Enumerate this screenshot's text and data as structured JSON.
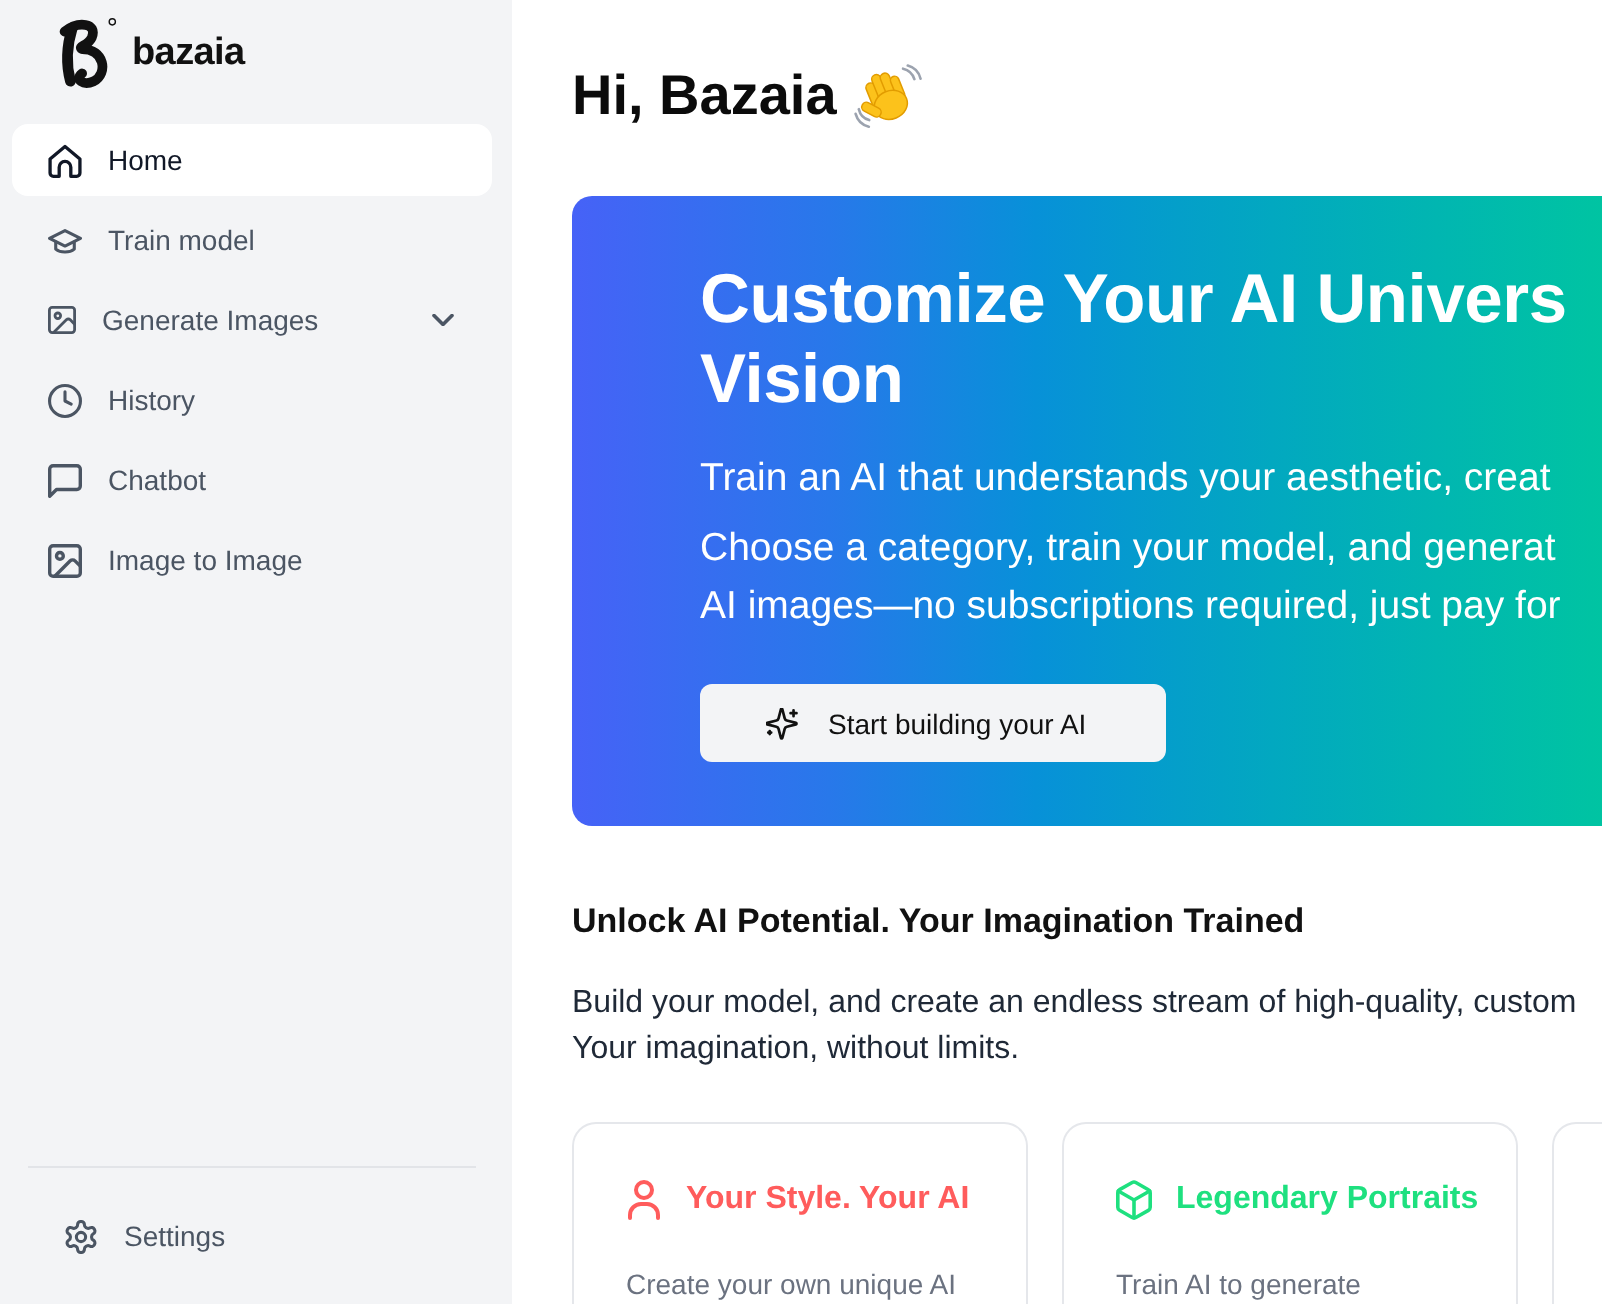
{
  "sidebar": {
    "brand": {
      "name": "bazaia"
    },
    "nav_items": [
      {
        "label": "Home",
        "selected": true,
        "kind": "link"
      },
      {
        "label": "Train model",
        "selected": false,
        "kind": "link"
      },
      {
        "label": "Generate Images",
        "selected": false,
        "kind": "group",
        "expanded": false
      },
      {
        "label": "History",
        "selected": false,
        "kind": "link"
      },
      {
        "label": "Chatbot",
        "selected": false,
        "kind": "link"
      },
      {
        "label": "Image to Image",
        "selected": false,
        "kind": "link"
      }
    ],
    "footer_items": [
      {
        "label": "Settings",
        "selected": false
      }
    ]
  },
  "main": {
    "greeting": "Hi, Bazaia",
    "hero": {
      "title_lines": [
        "Customize Your AI Univers",
        "Vision"
      ],
      "paragraphs": [
        [
          "Train an AI that understands your aesthetic, creat"
        ],
        [
          "Choose a category, train your model, and generat",
          "AI images—no subscriptions required, just pay for"
        ]
      ],
      "button": "Start building your AI"
    },
    "section": {
      "title": "Unlock AI Potential. Your Imagination Trained",
      "body_lines": [
        "Build your model, and create an endless stream of high-quality, custom",
        "Your imagination, without limits."
      ],
      "cards": [
        {
          "title": "Your Style. Your AI",
          "description": "Create your own unique AI",
          "color": "#ff5c5c"
        },
        {
          "title": "Legendary Portraits",
          "description": "Train AI to generate",
          "color": "#1ee07f"
        }
      ],
      "next_card_peek": true
    }
  }
}
